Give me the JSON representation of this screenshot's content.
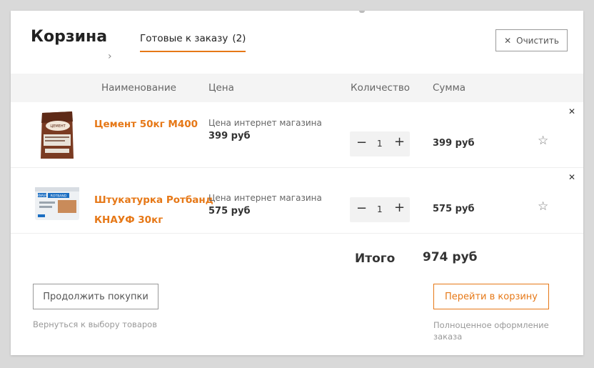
{
  "cart": {
    "title": "Корзина",
    "tab_label": "Готовые к заказу",
    "tab_count": "(2)",
    "clear_label": "Очистить"
  },
  "columns": {
    "name": "Наименование",
    "price": "Цена",
    "quantity": "Количество",
    "sum": "Сумма"
  },
  "items": [
    {
      "name_line1": "Цемент 50кг М400",
      "name_line2": "",
      "price_label": "Цена интернет магазина",
      "price": "399 руб",
      "quantity": "1",
      "sum": "399 руб",
      "image": "cement-bag"
    },
    {
      "name_line1": "Штукатурка Ротбанд",
      "name_line2": "КНАУФ 30кг",
      "price_label": "Цена интернет магазина",
      "price": "575 руб",
      "quantity": "1",
      "sum": "575 руб",
      "image": "plaster-bag"
    }
  ],
  "totals": {
    "label": "Итого",
    "value": "974 руб"
  },
  "actions": {
    "continue_label": "Продолжить покупки",
    "continue_hint": "Вернуться к выбору товаров",
    "checkout_label": "Перейти в корзину",
    "checkout_hint": "Полноценное оформление заказа"
  },
  "icons": {
    "clear": "close-icon",
    "remove": "close-icon",
    "favorite": "star-icon",
    "chevron": "chevron-right-icon"
  },
  "colors": {
    "accent": "#e67817",
    "header_bg": "#f4f4f4",
    "qty_bg": "#f2f2f2"
  }
}
